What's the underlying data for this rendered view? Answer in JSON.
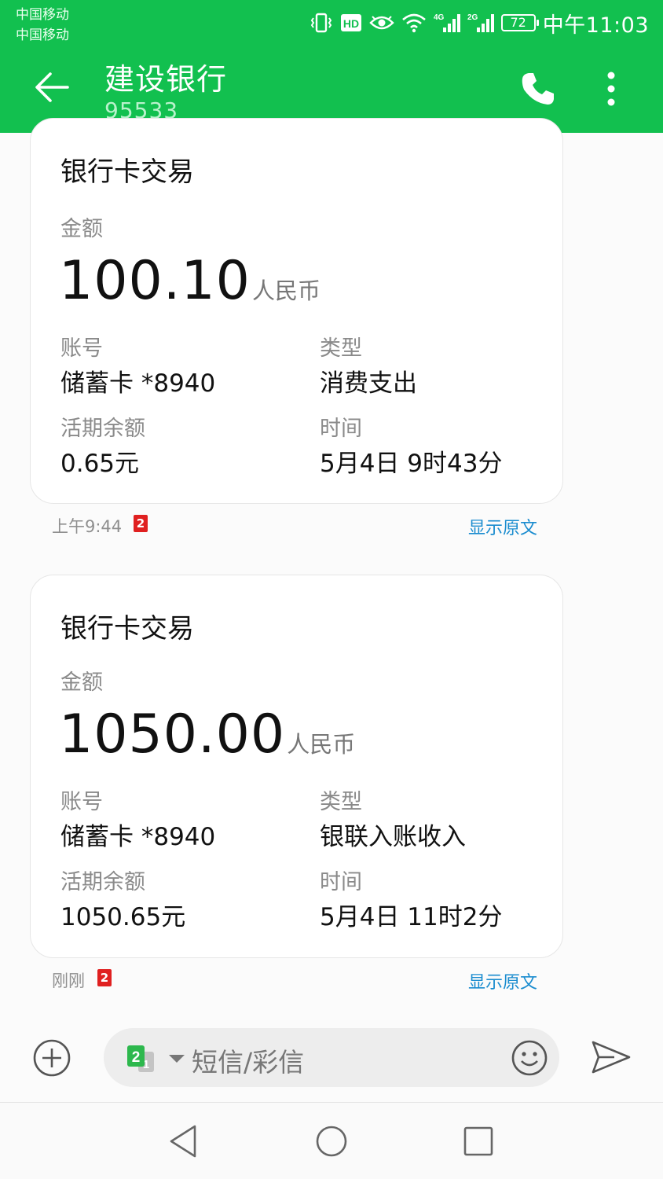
{
  "status_bar": {
    "carrier_1": "中国移动",
    "carrier_2": "中国移动",
    "battery": "72",
    "network_1": "4G",
    "network_2": "2G",
    "hd_label": "HD",
    "time": "中午11:03"
  },
  "header": {
    "title": "建设银行",
    "subtitle": "95533",
    "icons": [
      "back-arrow-icon",
      "phone-icon",
      "more-vertical-icon"
    ],
    "color": "#12c04f"
  },
  "messages": [
    {
      "heading": "银行卡交易",
      "amount_label": "金额",
      "amount": "100.10",
      "currency": "人民币",
      "account_label": "账号",
      "account": "储蓄卡 *8940",
      "type_label": "类型",
      "type": "消费支出",
      "balance_label": "活期余额",
      "balance": "0.65元",
      "time_label": "时间",
      "time": "5月4日 9时43分",
      "received": "上午9:44",
      "sim": "2",
      "show_raw": "显示原文"
    },
    {
      "heading": "银行卡交易",
      "amount_label": "金额",
      "amount": "1050.00",
      "currency": "人民币",
      "account_label": "账号",
      "account": "储蓄卡 *8940",
      "type_label": "类型",
      "type": "银联入账收入",
      "balance_label": "活期余额",
      "balance": "1050.65元",
      "time_label": "时间",
      "time": "5月4日 11时2分",
      "received": "刚刚",
      "sim": "2",
      "show_raw": "显示原文"
    }
  ],
  "compose": {
    "placeholder": "短信/彩信",
    "sim_selected": "2",
    "sim_other": "1",
    "icons": [
      "add-circle-icon",
      "sim-switch-icon",
      "emoji-icon",
      "send-icon"
    ]
  },
  "nav": {
    "icons": [
      "nav-back-icon",
      "nav-home-icon",
      "nav-recent-icon"
    ]
  },
  "colors": {
    "accent": "#12c04f",
    "link": "#1a8ccf",
    "sim_badge": "#e02020"
  }
}
